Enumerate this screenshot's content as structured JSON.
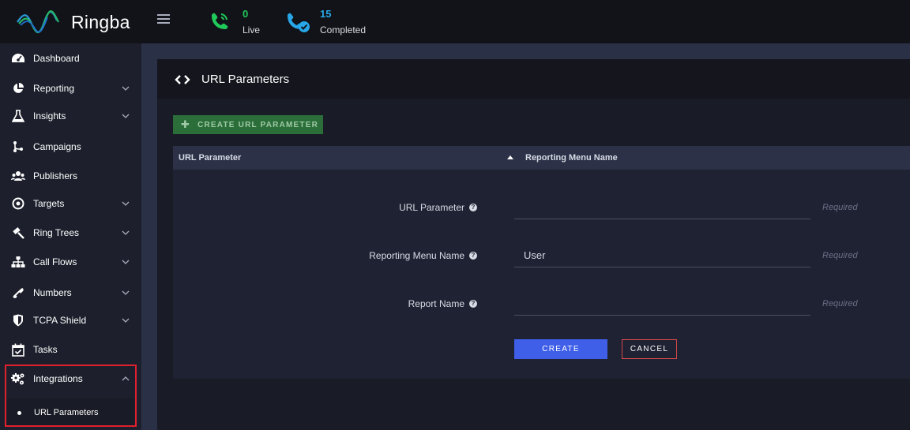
{
  "app": {
    "brand": "Ringba"
  },
  "header": {
    "live": {
      "count": "0",
      "label": "Live",
      "color": "#1fc95a"
    },
    "completed": {
      "count": "15",
      "label": "Completed",
      "color": "#27a7e8"
    }
  },
  "sidebar": {
    "items": [
      {
        "label": "Dashboard",
        "icon": "dashboard-icon",
        "expandable": false
      },
      {
        "label": "Reporting",
        "icon": "pie-chart-icon",
        "expandable": true
      },
      {
        "label": "Insights",
        "icon": "flask-icon",
        "expandable": true
      },
      {
        "label": "Campaigns",
        "icon": "branch-icon",
        "expandable": false
      },
      {
        "label": "Publishers",
        "icon": "users-icon",
        "expandable": false
      },
      {
        "label": "Targets",
        "icon": "target-icon",
        "expandable": true
      },
      {
        "label": "Ring Trees",
        "icon": "gavel-icon",
        "expandable": true
      },
      {
        "label": "Call Flows",
        "icon": "sitemap-icon",
        "expandable": true
      },
      {
        "label": "Numbers",
        "icon": "phone-icon",
        "expandable": true
      },
      {
        "label": "TCPA Shield",
        "icon": "shield-icon",
        "expandable": true
      },
      {
        "label": "Tasks",
        "icon": "calendar-check-icon",
        "expandable": false
      },
      {
        "label": "Integrations",
        "icon": "gears-icon",
        "expandable": true,
        "expanded": true
      }
    ],
    "sub_items": [
      {
        "label": "URL Parameters",
        "active": true
      }
    ]
  },
  "page": {
    "title": "URL Parameters",
    "create_button": "CREATE URL PARAMETER",
    "table": {
      "columns": [
        "URL Parameter",
        "Reporting Menu Name"
      ]
    },
    "form": {
      "fields": [
        {
          "label": "URL Parameter",
          "value": "",
          "required_text": "Required"
        },
        {
          "label": "Reporting Menu Name",
          "value": "User",
          "required_text": "Required"
        },
        {
          "label": "Report Name",
          "value": "",
          "required_text": "Required"
        }
      ],
      "submit_label": "CREATE",
      "cancel_label": "CANCEL"
    }
  },
  "colors": {
    "accent_blue": "#3f5fe8",
    "create_green": "#2b6e3a",
    "highlight_red": "#e0202d"
  }
}
